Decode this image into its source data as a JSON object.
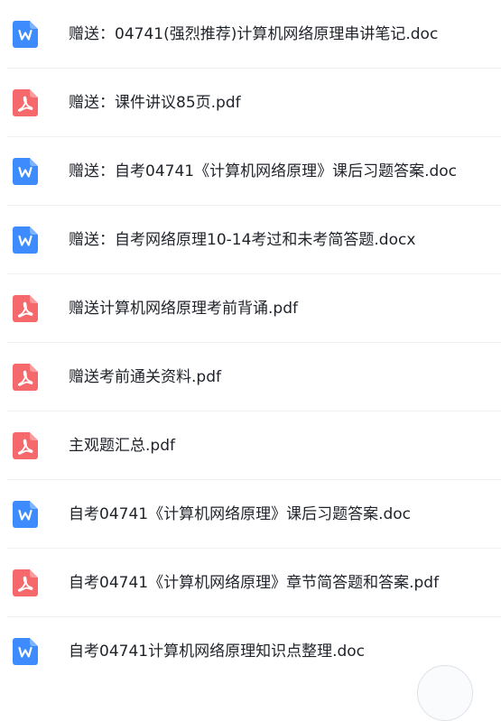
{
  "files": [
    {
      "name": "赠送：04741(强烈推荐)计算机网络原理串讲笔记.doc",
      "icon": "word-icon"
    },
    {
      "name": "赠送：课件讲议85页.pdf",
      "icon": "pdf-icon"
    },
    {
      "name": "赠送：自考04741《计算机网络原理》课后习题答案.doc",
      "icon": "word-icon"
    },
    {
      "name": "赠送：自考网络原理10-14考过和未考简答题.docx",
      "icon": "word-icon"
    },
    {
      "name": "赠送计算机网络原理考前背诵.pdf",
      "icon": "pdf-icon"
    },
    {
      "name": "赠送考前通关资料.pdf",
      "icon": "pdf-icon"
    },
    {
      "name": "主观题汇总.pdf",
      "icon": "pdf-icon"
    },
    {
      "name": "自考04741《计算机网络原理》课后习题答案.doc",
      "icon": "word-icon"
    },
    {
      "name": "自考04741《计算机网络原理》章节简答题和答案.pdf",
      "icon": "pdf-icon"
    },
    {
      "name": "自考04741计算机网络原理知识点整理.doc",
      "icon": "word-icon"
    }
  ],
  "colors": {
    "word": "#3d8bfd",
    "pdf": "#f5686b",
    "text": "#1f2329",
    "divider": "#eef0f3"
  }
}
